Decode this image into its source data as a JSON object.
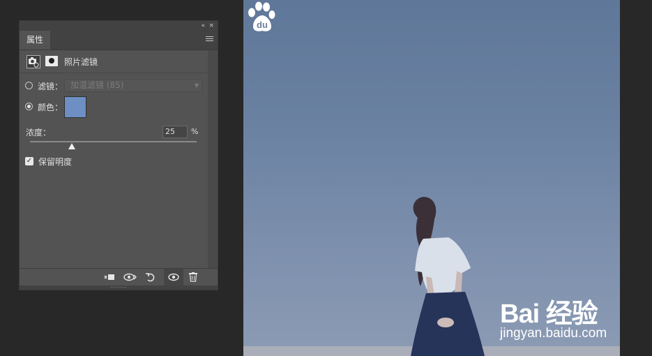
{
  "panel": {
    "tab_label": "属性",
    "header_title": "照片滤镜",
    "filter_label": "滤镜：",
    "filter_selected": "加温滤镜 (85)",
    "color_label": "颜色：",
    "filter_color": "#6d8fc3",
    "density_label": "浓度：",
    "density_value": "25",
    "density_unit": "%",
    "density_level": 25,
    "preserve_luminosity_label": "保留明度",
    "preserve_luminosity_checked": true,
    "selected_option": "color"
  },
  "icons": {
    "panel_collapse": "«",
    "panel_close": "×",
    "footer": [
      "clip-to-layer-icon",
      "view-previous-state-icon",
      "reset-icon",
      "visibility-eye-icon",
      "trash-icon"
    ]
  },
  "watermark": {
    "logo": "Bai  经验",
    "url": "jingyan.baidu.com"
  }
}
